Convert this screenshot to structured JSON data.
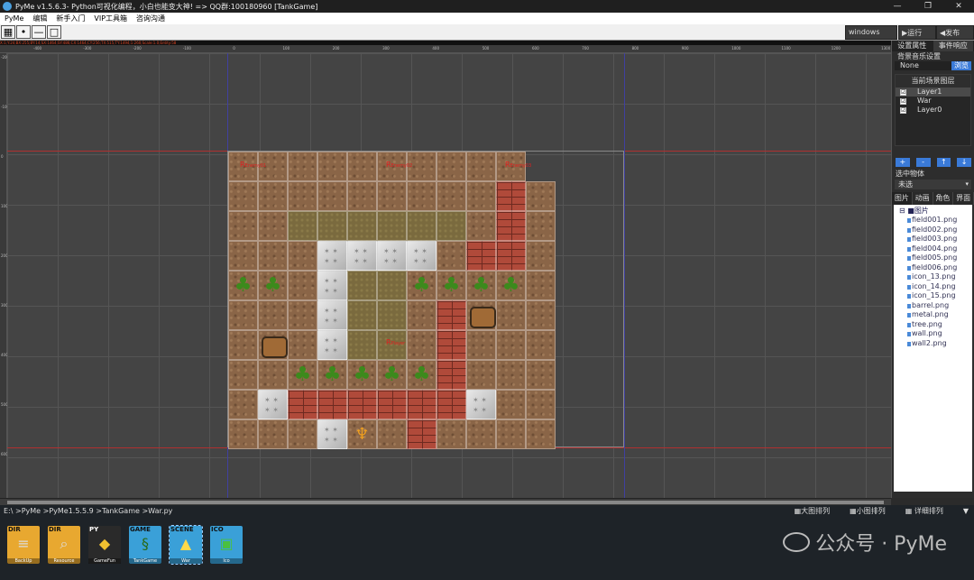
{
  "window": {
    "title": "PyMe v1.5.6.3- Python可视化编程，小白也能变大神!    => QQ群:100180960    [TankGame]",
    "controls": [
      "—",
      "❐",
      "✕"
    ]
  },
  "menu": [
    "PyMe",
    "编辑",
    "新手入门",
    "VIP工具箱",
    "咨询沟通"
  ],
  "toolbar": {
    "platform": "windows",
    "run_label": "▶运行",
    "publish_label": "◀发布"
  },
  "coord_text": "X:1;Y:24;BX:255;BY:14;SX:1464;SY:486;CX:1464;CY:256;TX:515;TY:1494;1:260;Scale:1.0;Entity:58",
  "ruler_h": [
    "-400",
    "-300",
    "-200",
    "-100",
    "0",
    "100",
    "200",
    "300",
    "400",
    "500",
    "600",
    "700",
    "800",
    "900",
    "1000",
    "1100",
    "1200",
    "1300"
  ],
  "ruler_v": [
    "-200",
    "-100",
    "0",
    "100",
    "200",
    "300",
    "400",
    "500",
    "600"
  ],
  "spawn_labels": [
    "Enemy01",
    "Enemy02",
    "Enemy03",
    "Player"
  ],
  "right_panel": {
    "tabs": [
      "设置属性",
      "事件响应"
    ],
    "music_label": "背景音乐设置",
    "music_value": "None",
    "browse_label": "浏览",
    "layer_title": "当前场景图层",
    "layers": [
      {
        "name": "Layer1",
        "checked": "☑"
      },
      {
        "name": "War",
        "checked": "☑"
      },
      {
        "name": "Layer0",
        "checked": "☑"
      }
    ],
    "layer_buttons": [
      "+",
      "-",
      "↑",
      "↓"
    ],
    "selected_label": "选中物体",
    "selected_value": "未选",
    "res_tabs": [
      "图片",
      "动画",
      "角色",
      "界面"
    ],
    "folder": "图片",
    "files": [
      "field001.png",
      "field002.png",
      "field003.png",
      "field004.png",
      "field005.png",
      "field006.png",
      "icon_13.png",
      "icon_14.png",
      "icon_15.png",
      "barrel.png",
      "metal.png",
      "tree.png",
      "wall.png",
      "wall2.png"
    ]
  },
  "bottom": {
    "path": "E:\\ >PyMe >PyMe1.5.5.9 >TankGame >War.py",
    "view_options": [
      "大图排列",
      "小图排列",
      "详细排列"
    ],
    "files": [
      {
        "tag": "DIR",
        "name": "BackUp"
      },
      {
        "tag": "DIR",
        "name": "Resource"
      },
      {
        "tag": "PY",
        "name": "GameFun"
      },
      {
        "tag": "GAME",
        "name": "TankGame"
      },
      {
        "tag": "SCENE",
        "name": "War"
      },
      {
        "tag": "ICO",
        "name": "Ico"
      }
    ]
  },
  "watermark": "公众号 · PyMe",
  "map_rows": [
    "ddddddddddx",
    "dddddddddwd",
    "ddggggggdwd",
    "dddmmmmdwwd",
    "ttdmggtttt.",
    "dddmggdwbdd",
    "dbdmggdwddd",
    "ddtttttwddd",
    "dmwwwwwwmdd",
    "dddmedwddd."
  ]
}
